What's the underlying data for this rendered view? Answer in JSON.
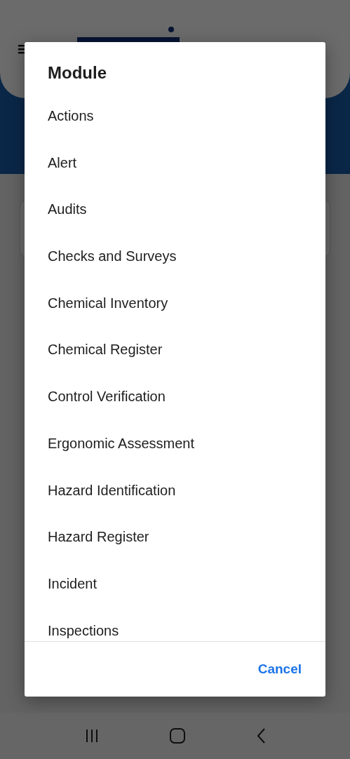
{
  "dialog": {
    "title": "Module",
    "items": [
      "Actions",
      "Alert",
      "Audits",
      "Checks and Surveys",
      "Chemical Inventory",
      "Chemical Register",
      "Control Verification",
      "Ergonomic Assessment",
      "Hazard Identification",
      "Hazard Register",
      "Incident",
      "Inspections"
    ],
    "buttons": [
      "Cancel"
    ]
  }
}
